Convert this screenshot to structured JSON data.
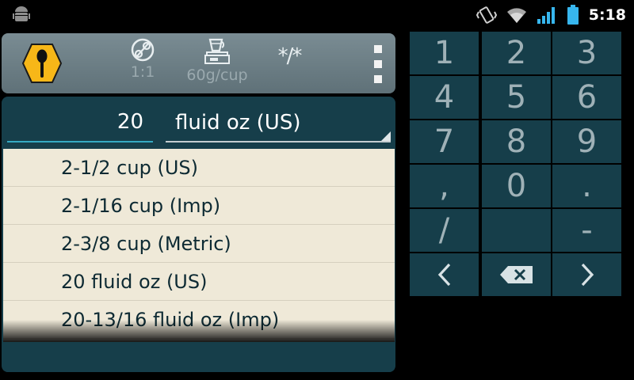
{
  "status_bar": {
    "time": "5:18",
    "icons": [
      "android-debug-icon",
      "vibrate-icon",
      "wifi-icon",
      "signal-icon",
      "battery-icon"
    ]
  },
  "action_bar": {
    "logo_icon": "spoon-hexagon-icon",
    "ratio": {
      "icon": "scale-icon",
      "label": "1:1"
    },
    "density": {
      "icon": "cup-on-scale-icon",
      "label": "60g/cup"
    },
    "fraction": {
      "icon": "fraction-icon",
      "glyph": "*/*"
    },
    "overflow_icon": "overflow-menu-icon"
  },
  "converter": {
    "quantity": "20",
    "unit": "fluid oz (US)",
    "results": [
      "2-1/2 cup (US)",
      "2-1/16 cup (Imp)",
      "2-3/8 cup (Metric)",
      "20 fluid oz (US)",
      "20-13/16 fluid oz (Imp)"
    ]
  },
  "keypad": {
    "keys": [
      "1",
      "2",
      "3",
      "4",
      "5",
      "6",
      "7",
      "8",
      "9",
      ",",
      "0",
      ".",
      "/",
      "",
      "-"
    ],
    "nav": {
      "left": "<",
      "right": ">",
      "backspace_icon": "backspace-icon"
    }
  },
  "colors": {
    "panel": "#163e4a",
    "result_bg": "#efe9d8",
    "accent": "#35a9c2",
    "logo": "#f7b718"
  }
}
